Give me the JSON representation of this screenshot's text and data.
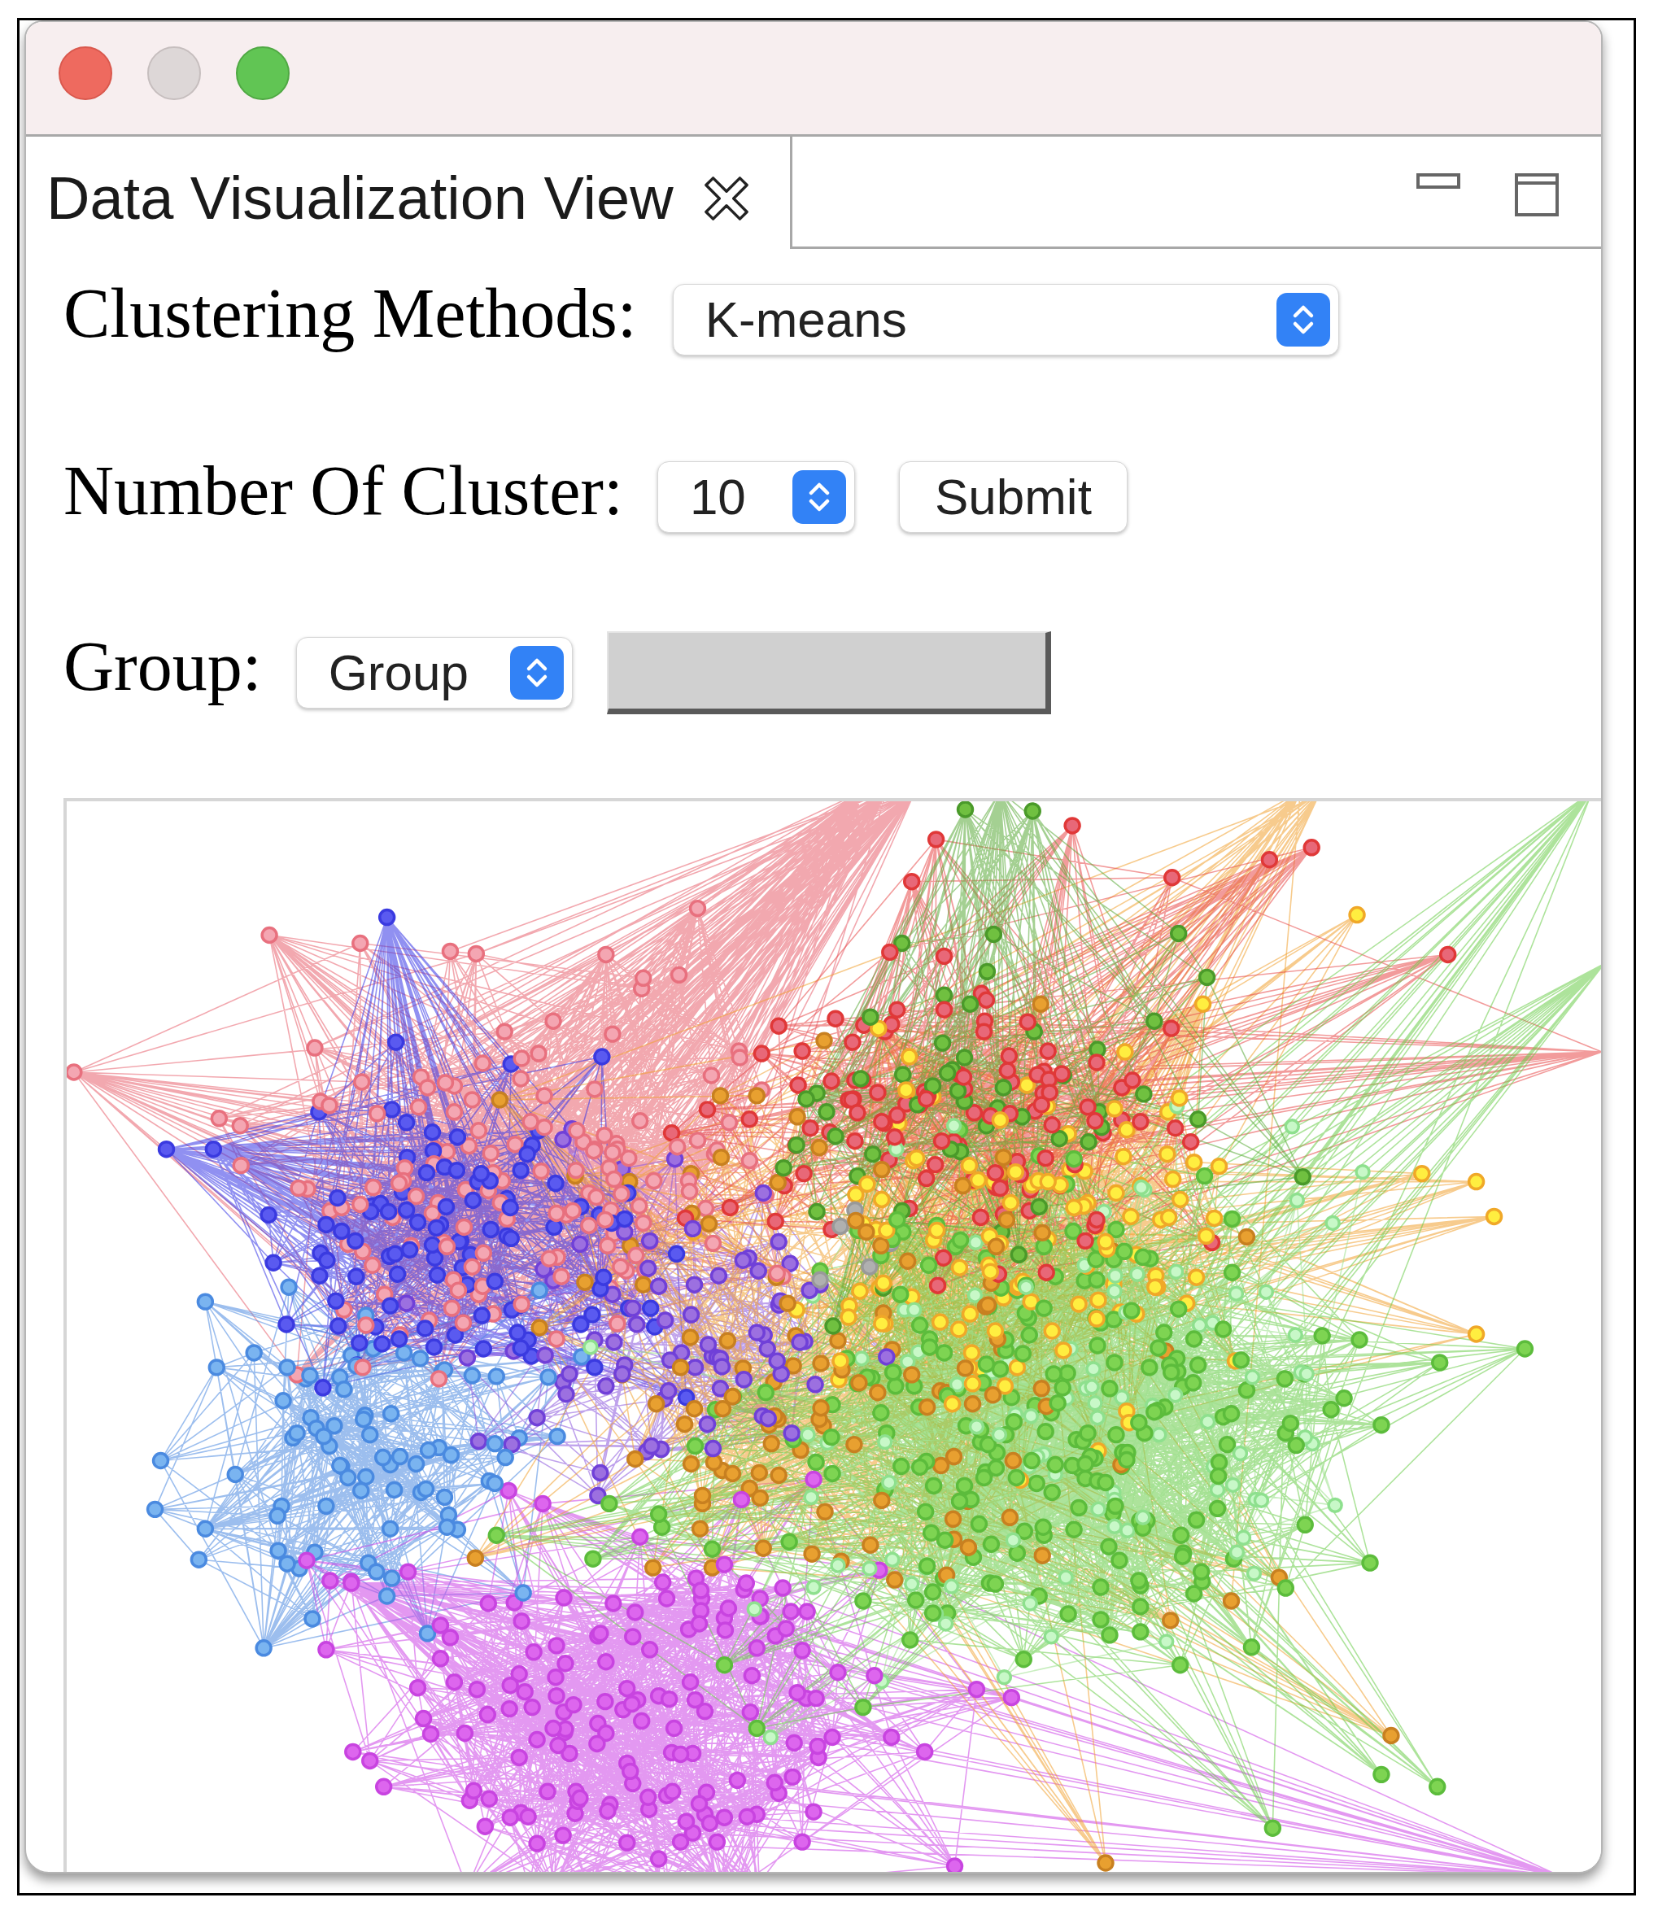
{
  "tabs": [
    {
      "label": "Data Visualization View",
      "selected": true
    }
  ],
  "form": {
    "clustering_method": {
      "label": "Clustering Methods:",
      "value": "K-means"
    },
    "cluster_count": {
      "label": "Number Of Cluster:",
      "value": "10"
    },
    "submit_button": {
      "label": "Submit"
    },
    "group": {
      "label": "Group:",
      "value": "Group"
    }
  }
}
